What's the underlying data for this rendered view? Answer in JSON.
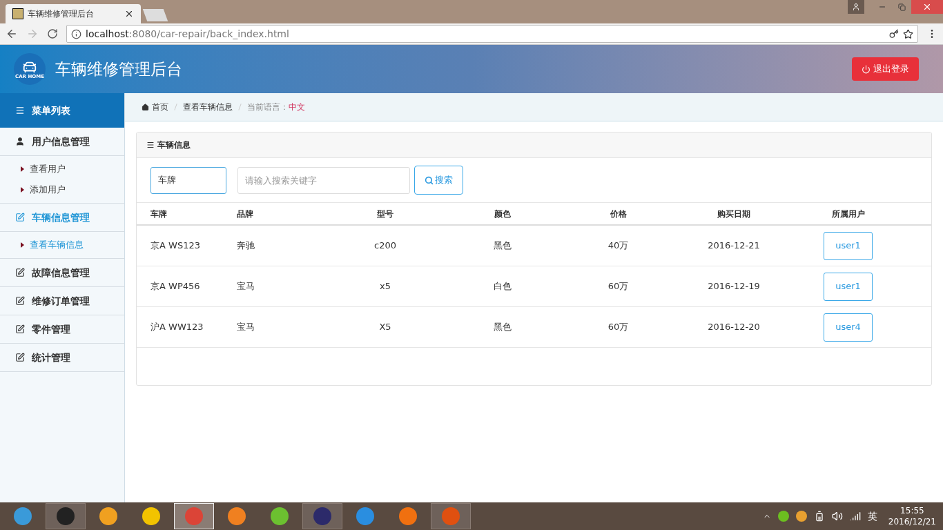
{
  "browser": {
    "tab_title": "车辆维修管理后台",
    "url_host": "localhost",
    "url_rest": ":8080/car-repair/back_index.html"
  },
  "header": {
    "title": "车辆维修管理后台",
    "logo_text": "CAR HOME",
    "logout": "退出登录"
  },
  "sidebar": {
    "title": "菜单列表",
    "groups": [
      {
        "label": "用户信息管理",
        "kind": "user",
        "selected": false,
        "children": [
          {
            "label": "查看用户",
            "selected": false
          },
          {
            "label": "添加用户",
            "selected": false
          }
        ]
      },
      {
        "label": "车辆信息管理",
        "kind": "edit",
        "selected": true,
        "children": [
          {
            "label": "查看车辆信息",
            "selected": true
          }
        ]
      },
      {
        "label": "故障信息管理",
        "kind": "edit",
        "selected": false
      },
      {
        "label": "维修订单管理",
        "kind": "edit",
        "selected": false
      },
      {
        "label": "零件管理",
        "kind": "edit",
        "selected": false
      },
      {
        "label": "统计管理",
        "kind": "edit",
        "selected": false
      }
    ]
  },
  "breadcrumb": {
    "home": "首页",
    "current": "查看车辆信息",
    "lang_label": "当前语言：",
    "lang": "中文"
  },
  "panel": {
    "title": "车辆信息",
    "filter": "车牌",
    "search_placeholder": "请输入搜索关键字",
    "search_button": "搜索"
  },
  "table": {
    "columns": [
      "车牌",
      "品牌",
      "型号",
      "颜色",
      "价格",
      "购买日期",
      "所属用户"
    ],
    "rows": [
      {
        "cells": [
          "京A WS123",
          "奔驰",
          "c200",
          "黑色",
          "40万",
          "2016-12-21"
        ],
        "user": "user1"
      },
      {
        "cells": [
          "京A WP456",
          "宝马",
          "x5",
          "白色",
          "60万",
          "2016-12-19"
        ],
        "user": "user1"
      },
      {
        "cells": [
          "沪A WW123",
          "宝马",
          "X5",
          "黑色",
          "60万",
          "2016-12-20"
        ],
        "user": "user4"
      }
    ]
  },
  "taskbar": {
    "apps": [
      {
        "color": "#3a9ad9",
        "running": false,
        "selected": false
      },
      {
        "color": "#222222",
        "running": true,
        "selected": false
      },
      {
        "color": "#f0a020",
        "running": false,
        "selected": false
      },
      {
        "color": "#f2c300",
        "running": false,
        "selected": false
      },
      {
        "color": "#db4437",
        "running": true,
        "selected": true
      },
      {
        "color": "#f08020",
        "running": false,
        "selected": false
      },
      {
        "color": "#6cc030",
        "running": false,
        "selected": false
      },
      {
        "color": "#2c2a6a",
        "running": true,
        "selected": false
      },
      {
        "color": "#2a8ee0",
        "running": false,
        "selected": false
      },
      {
        "color": "#f07010",
        "running": false,
        "selected": false
      },
      {
        "color": "#e05010",
        "running": true,
        "selected": false
      }
    ],
    "ime": "英",
    "time": "15:55",
    "date": "2016/12/21"
  }
}
